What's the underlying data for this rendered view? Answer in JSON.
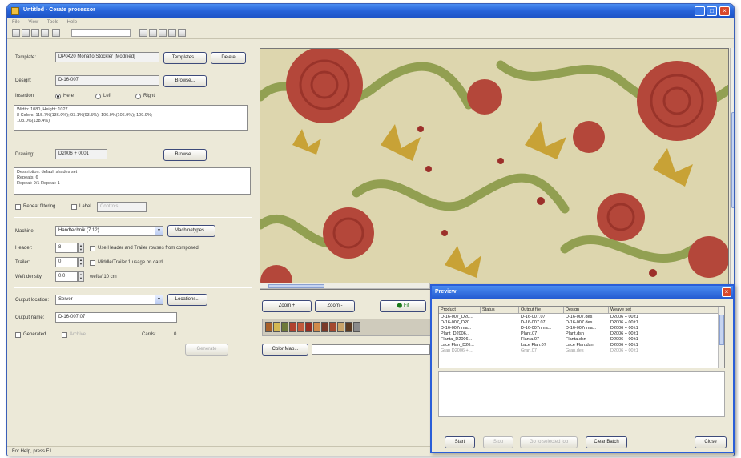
{
  "window": {
    "title": "Untitled - Cerate processor"
  },
  "menu": [
    "File",
    "View",
    "Tools",
    "Help"
  ],
  "template": {
    "label": "Template:",
    "value": "DP0420 Monaflo Stockler [Modified]",
    "templates_button": "Templates...",
    "delete_button": "Delete"
  },
  "design": {
    "label": "Design:",
    "value": "D-16-007",
    "browse_button": "Browse..."
  },
  "insertion": {
    "label": "Insertion",
    "options": [
      "Here",
      "Left",
      "Right"
    ],
    "selected": "Here"
  },
  "design_info": "Width: 1080, Height: 1027\n8 Colors, 115.7%(136.0%); 93.1%(93.5%); 106.9%(106.9%); 109.9%;\n103.0%(138.4%)",
  "drawing": {
    "label": "Drawing:",
    "value": "D2006 + 0001",
    "browse_button": "Browse..."
  },
  "description": "Description: default shades set\nRepeats: 6\nRepeat: 9/1 Repeat: 1",
  "filter": {
    "repeat_label": "Repeat filtering",
    "label_label": "Label",
    "label_value": "Controls"
  },
  "machine": {
    "label": "Machine:",
    "value": "Handtechnik (7 12)",
    "button": "Machinetypes..."
  },
  "header": {
    "label": "Header:",
    "value": "8"
  },
  "trailer": {
    "label": "Trailer:",
    "value": "0"
  },
  "header_option": "Use Header and Trailer rowses from composed",
  "trailer_option": "Middle/Trailer 1 usage on card",
  "weft": {
    "label": "Weft density:",
    "value": "0.0",
    "unit": "wefts/ 10 cm"
  },
  "output": {
    "location_label": "Output location:",
    "location_value": "Server",
    "location_button": "Locations...",
    "name_label": "Output name:",
    "name_value": "D-16-007.07",
    "cards_label": "Cards:",
    "cards_value": "0",
    "generated_label": "Generated",
    "archive_label": "Archive",
    "generate_button": "Generate"
  },
  "viewer": {
    "zoom_in": "Zoom +",
    "zoom_out": "Zoom -",
    "fit": "Fit",
    "color_map": "Color Map..."
  },
  "swatches": [
    "#a8602a",
    "#d4b852",
    "#6e7a3a",
    "#b0422e",
    "#c25a3c",
    "#962e22",
    "#d08a4a",
    "#7a3a28",
    "#a4482e",
    "#c9a46a",
    "#5c3a22",
    "#8a8a8a"
  ],
  "preview": {
    "title": "Preview",
    "columns": [
      "Product",
      "Status",
      "Output file",
      "Design",
      "Weave set"
    ],
    "rows": [
      [
        "D-16-007_D20...",
        "",
        "D-16-007.07",
        "D-16-007.des",
        "D2006 + 00.t1"
      ],
      [
        "D-16-007_D20...",
        "",
        "D-16-007.07",
        "D-16-007.des",
        "D2006 + 00.t1"
      ],
      [
        "D-16-007nma...",
        "",
        "D-16-007nma...",
        "D-16-007nma...",
        "D2006 + 00.t1"
      ],
      [
        "Plant_D2006...",
        "",
        "Plant.07",
        "Plant.dsn",
        "D2006 + 00.t1"
      ],
      [
        "Flanta_D2006...",
        "",
        "Flanta.07",
        "Flanta.dsn",
        "D2006 + 00.t1"
      ],
      [
        "Lace Flan_D20...",
        "",
        "Lace Flan.07",
        "Lace Flan.dsn",
        "D2006 + 00.t1"
      ],
      [
        "Gran D2006 + ...",
        "",
        "Gran.07",
        "Gran.des",
        "D2006 + 00.t1"
      ]
    ],
    "buttons": [
      "Start",
      "Stop",
      "Go to selected job",
      "Clear Batch",
      "Close"
    ]
  },
  "status_text": "For Help, press F1"
}
